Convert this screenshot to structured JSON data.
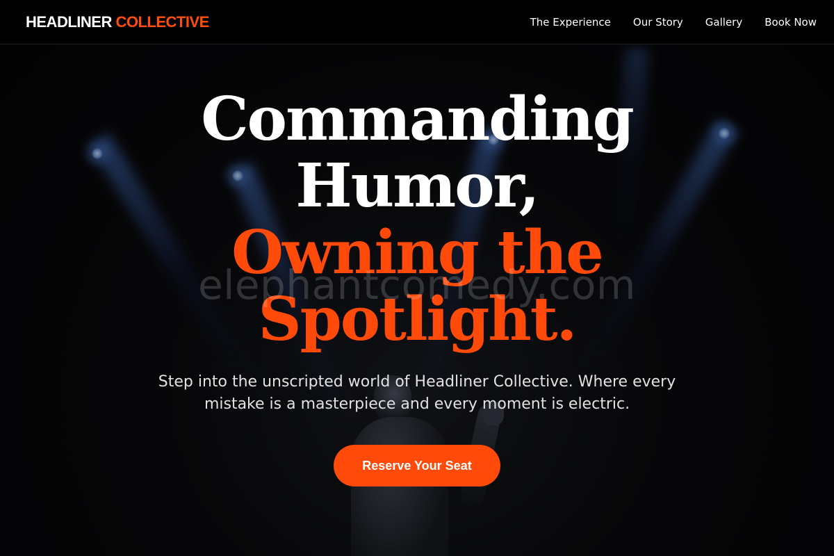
{
  "brand": {
    "name_main": "HEADLINER",
    "name_accent": "COLLECTIVE"
  },
  "nav": {
    "items": [
      {
        "label": "The Experience"
      },
      {
        "label": "Our Story"
      },
      {
        "label": "Gallery"
      },
      {
        "label": "Book Now"
      }
    ]
  },
  "hero": {
    "headline_line1": "Commanding",
    "headline_line2": "Humor,",
    "headline_line3": "Owning the",
    "headline_line4": "Spotlight.",
    "subtitle": "Step into the unscripted world of Headliner Collective. Where every mistake is a masterpiece and every moment is electric.",
    "cta_label": "Reserve Your Seat"
  },
  "watermark": "elephantcomedy.com",
  "colors": {
    "accent": "#ff4a0a",
    "nav_bg": "#000000",
    "page_bg": "#050505"
  },
  "icons": [
    "stage-spotlight-icon",
    "performer-silhouette"
  ]
}
